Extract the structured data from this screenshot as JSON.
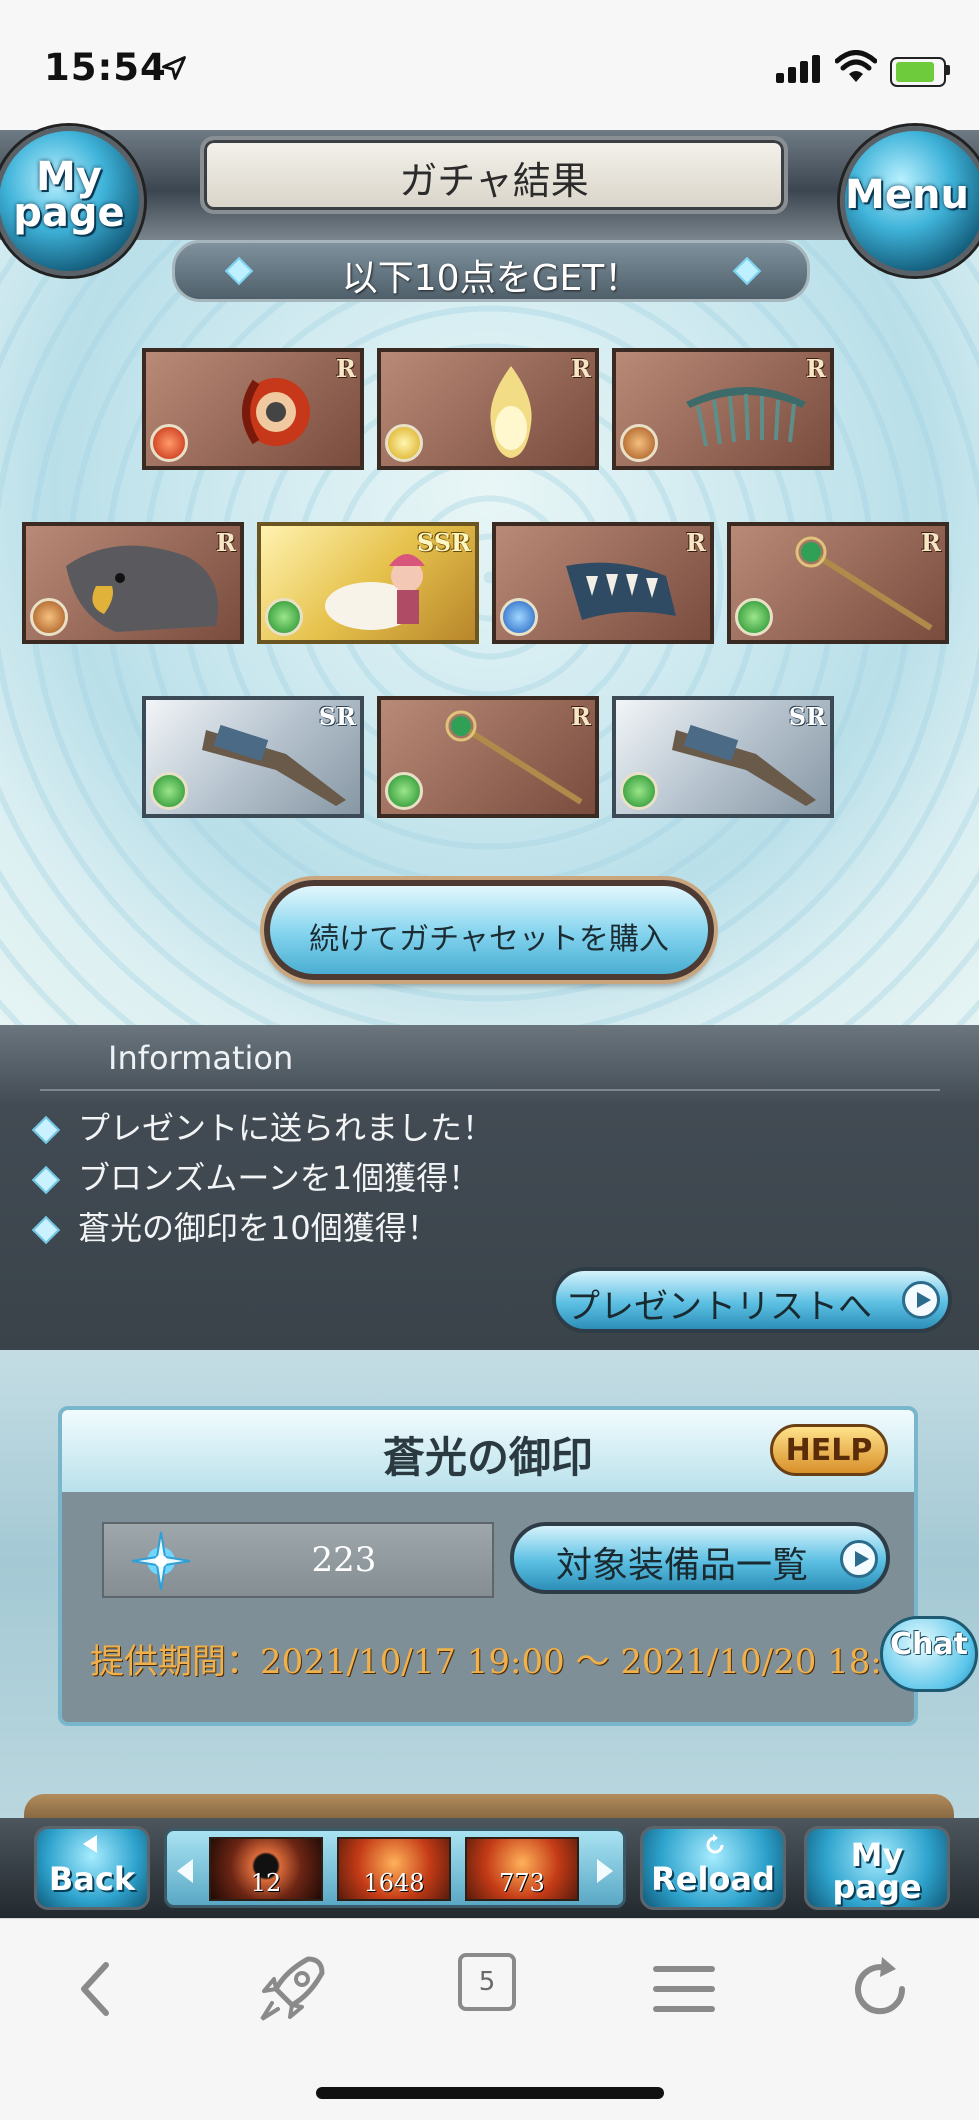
{
  "status_bar": {
    "time": "15:54"
  },
  "header": {
    "title": "ガチャ結果",
    "mypage_label_1": "My",
    "mypage_label_2": "page",
    "menu_label": "Menu"
  },
  "banner": {
    "text": "以下10点をGET！"
  },
  "items": [
    {
      "rarity": "R",
      "element": "fire",
      "icon": "axe-weapon-icon"
    },
    {
      "rarity": "R",
      "element": "light",
      "icon": "flame-spirit-icon"
    },
    {
      "rarity": "R",
      "element": "earth",
      "icon": "comb-weapon-icon"
    },
    {
      "rarity": "R",
      "element": "earth",
      "icon": "eagle-summon-icon"
    },
    {
      "rarity": "SSR",
      "element": "wind",
      "icon": "character-portrait-icon"
    },
    {
      "rarity": "R",
      "element": "water",
      "icon": "claw-weapon-icon"
    },
    {
      "rarity": "R",
      "element": "wind",
      "icon": "staff-weapon-icon"
    },
    {
      "rarity": "SR",
      "element": "wind",
      "icon": "gauntlet-weapon-icon"
    },
    {
      "rarity": "R",
      "element": "wind",
      "icon": "staff-weapon-icon"
    },
    {
      "rarity": "SR",
      "element": "wind",
      "icon": "gauntlet-weapon-icon"
    }
  ],
  "buy_button": {
    "label": "続けてガチャセットを購入"
  },
  "information": {
    "title": "Information",
    "lines": [
      "プレゼントに送られました！",
      "ブロンズムーンを1個獲得！",
      "蒼光の御印を10個獲得！"
    ],
    "present_button": "プレゼントリストへ"
  },
  "seal": {
    "title": "蒼光の御印",
    "help": "HELP",
    "count": "223",
    "equip_button": "対象装備品一覧",
    "period": "提供期間：2021/10/17 19:00 〜 2021/10/20 18:59"
  },
  "chat": {
    "label": "Chat"
  },
  "bottom_nav": {
    "back": "Back",
    "reload": "Reload",
    "mypage_1": "My",
    "mypage_2": "page",
    "strip_counts": [
      "12",
      "1648",
      "773"
    ]
  },
  "browser": {
    "tab_count": "5"
  },
  "colors": {
    "card_r": "#9c6b5a",
    "card_ssr": "#e6c24d",
    "card_sr": "#b7c4cf",
    "info_bg": "#424b53",
    "period_text": "#f0b04a"
  }
}
